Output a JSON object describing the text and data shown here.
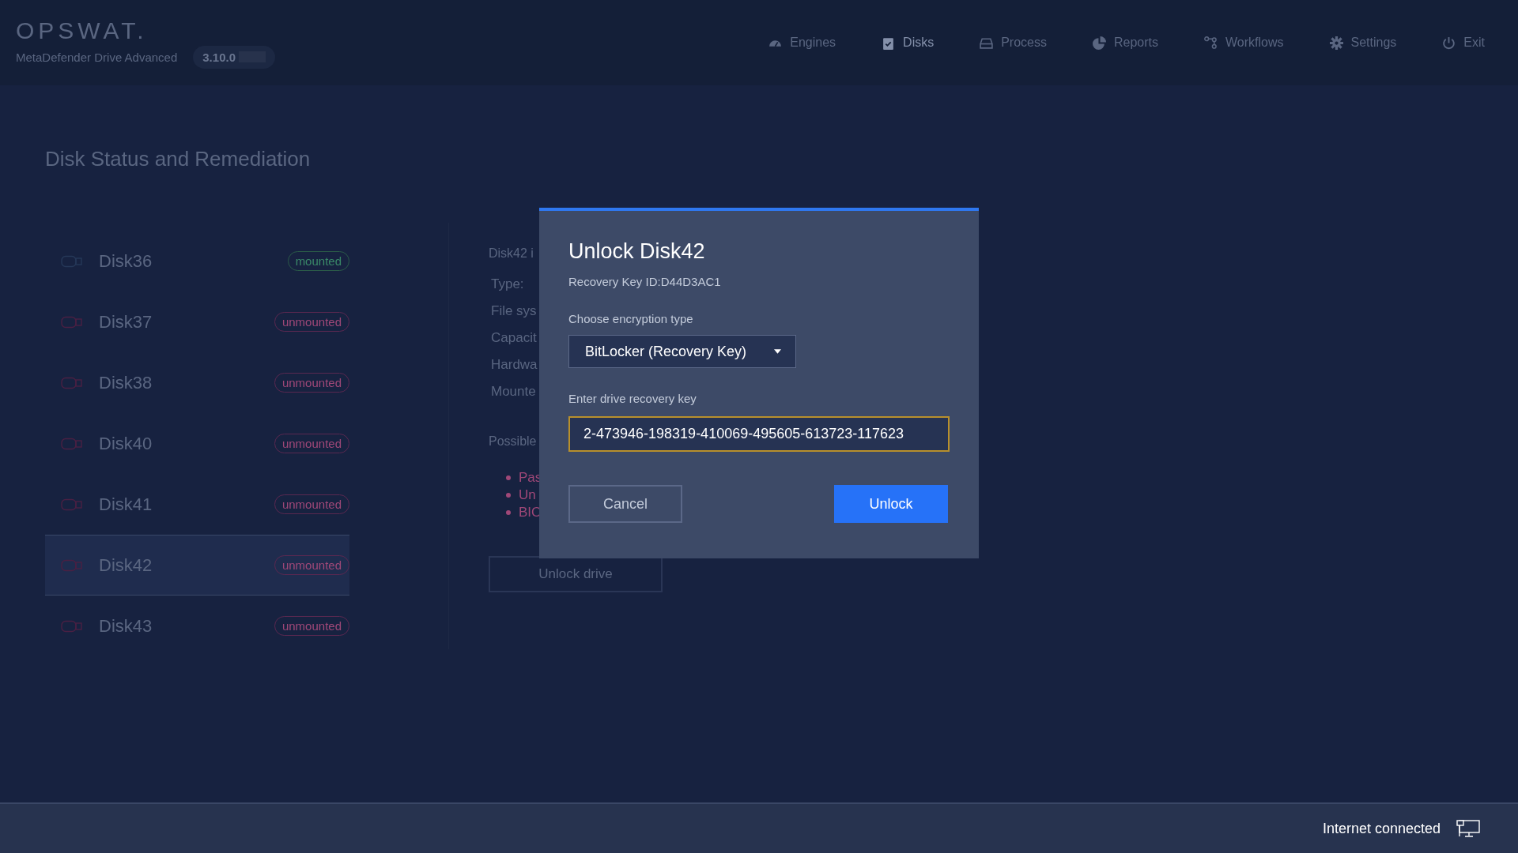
{
  "header": {
    "logo": "OPSWAT.",
    "product": "MetaDefender Drive Advanced",
    "version": "3.10.0"
  },
  "nav": [
    {
      "label": "Engines",
      "kind": "gauge",
      "selected": false
    },
    {
      "label": "Disks",
      "kind": "clipboard",
      "selected": true
    },
    {
      "label": "Process",
      "kind": "drive",
      "selected": false
    },
    {
      "label": "Reports",
      "kind": "pie",
      "selected": false
    },
    {
      "label": "Workflows",
      "kind": "nodes",
      "selected": false
    },
    {
      "label": "Settings",
      "kind": "gear",
      "selected": false
    },
    {
      "label": "Exit",
      "kind": "power",
      "selected": false
    }
  ],
  "page_title": "Disk Status and Remediation",
  "disks": [
    {
      "name": "Disk36",
      "status": "mounted",
      "kind": "mounted",
      "selected": false
    },
    {
      "name": "Disk37",
      "status": "unmounted",
      "kind": "unmounted",
      "selected": false
    },
    {
      "name": "Disk38",
      "status": "unmounted",
      "kind": "unmounted",
      "selected": false
    },
    {
      "name": "Disk40",
      "status": "unmounted",
      "kind": "unmounted",
      "selected": false
    },
    {
      "name": "Disk41",
      "status": "unmounted",
      "kind": "unmounted",
      "selected": false
    },
    {
      "name": "Disk42",
      "status": "unmounted",
      "kind": "unmounted",
      "selected": true
    },
    {
      "name": "Disk43",
      "status": "unmounted",
      "kind": "unmounted",
      "selected": false
    }
  ],
  "detail": {
    "heading": "Disk42 i",
    "fields": [
      "Type:",
      "File sys",
      "Capacit",
      "Hardwa",
      "Mounte"
    ],
    "possible": "Possible",
    "reasons": [
      "Pas",
      "Un",
      "BIO"
    ],
    "button": "Unlock drive"
  },
  "dialog": {
    "title": "Unlock Disk42",
    "key_id": "Recovery Key ID:D44D3AC1",
    "encryption_label": "Choose encryption type",
    "encryption_value": "BitLocker (Recovery Key)",
    "key_label": "Enter drive recovery key",
    "key_value": "2-473946-198319-410069-495605-613723-117623",
    "cancel": "Cancel",
    "unlock": "Unlock"
  },
  "status_bar": {
    "text": "Internet connected"
  }
}
